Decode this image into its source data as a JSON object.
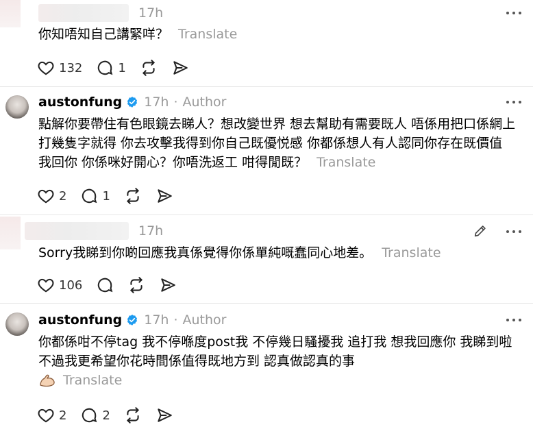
{
  "posts": [
    {
      "username": "",
      "time": "17h",
      "author": "",
      "text": "你知唔知自己講緊咩？",
      "translate": "Translate",
      "likes": "132",
      "replies": "1"
    },
    {
      "username": "austonfung",
      "time": "17h",
      "author": "Author",
      "text": "點解你要帶住有色眼鏡去睇人？想改變世界 想去幫助有需要既人 唔係用把口係網上打幾隻字就得 你去攻擊我得到你自己既優悦感 你都係想人有人認同你存在既價值 我回你 你係咪好開心？你唔洗返工 咁得閒既？",
      "translate": "Translate",
      "likes": "2",
      "replies": "1"
    },
    {
      "username": "",
      "time": "17h",
      "author": "",
      "text": "Sorry我睇到你啲回應我真係覺得你係單純嘅蠢同心地差。",
      "translate": "Translate",
      "likes": "106",
      "replies": ""
    },
    {
      "username": "austonfung",
      "time": "17h",
      "author": "Author",
      "text": "你都係咁不停tag 我不停喺度post我 不停幾日￼騷擾我 ￼追打我 想我回應你 我睇到啦 不過我更希望你花時間係值得既地方到 ￼認真做認真的事",
      "translate": "Translate",
      "likes": "2",
      "replies": "2"
    }
  ],
  "icons": {
    "like": "heart-icon",
    "reply": "comment-icon",
    "repost": "repost-icon",
    "share": "send-icon",
    "more": "more-icon",
    "verified": "verified-badge-icon",
    "edit": "pencil-icon",
    "emoji": "flexed-biceps-emoji"
  },
  "colors": {
    "verified": "#1d9bf0",
    "muted": "#999999",
    "divider": "#e6e6e6"
  }
}
